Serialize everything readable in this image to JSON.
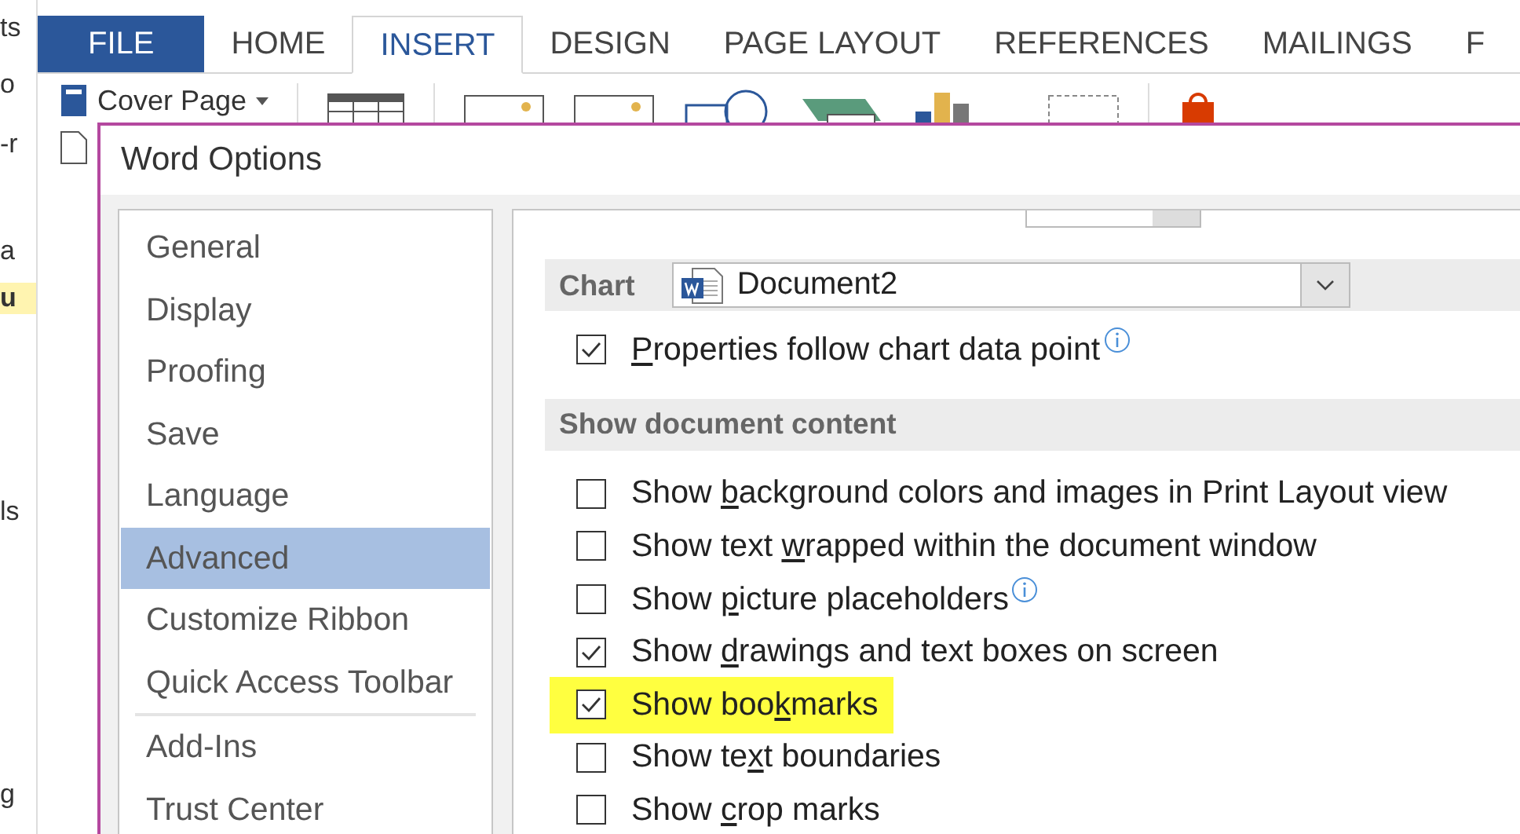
{
  "background_fragments": [
    {
      "text": "ts",
      "highlighted": false
    },
    {
      "text": "o",
      "highlighted": false
    },
    {
      "text": "-r",
      "highlighted": false
    },
    {
      "text": "a",
      "highlighted": false
    },
    {
      "text": "u",
      "highlighted": true
    },
    {
      "text": "ls",
      "highlighted": false
    },
    {
      "text": "g",
      "highlighted": false
    }
  ],
  "ribbon_tabs": [
    {
      "label": "FILE",
      "kind": "file",
      "selected": false
    },
    {
      "label": "HOME",
      "kind": "tab",
      "selected": false
    },
    {
      "label": "INSERT",
      "kind": "tab",
      "selected": true
    },
    {
      "label": "DESIGN",
      "kind": "tab",
      "selected": false
    },
    {
      "label": "PAGE LAYOUT",
      "kind": "tab",
      "selected": false
    },
    {
      "label": "REFERENCES",
      "kind": "tab",
      "selected": false
    },
    {
      "label": "MAILINGS",
      "kind": "tab",
      "selected": false
    },
    {
      "label": "F",
      "kind": "tab",
      "selected": false
    }
  ],
  "ribbon": {
    "cover_page": "Cover Page"
  },
  "dialog": {
    "title": "Word Options",
    "nav_groups": [
      [
        {
          "label": "General",
          "selected": false
        },
        {
          "label": "Display",
          "selected": false
        },
        {
          "label": "Proofing",
          "selected": false
        },
        {
          "label": "Save",
          "selected": false
        },
        {
          "label": "Language",
          "selected": false
        },
        {
          "label": "Advanced",
          "selected": true
        },
        {
          "label": "Customize Ribbon",
          "selected": false
        },
        {
          "label": "Quick Access Toolbar",
          "selected": false
        }
      ],
      [
        {
          "label": "Add-Ins",
          "selected": false
        },
        {
          "label": "Trust Center",
          "selected": false
        }
      ]
    ],
    "content": [
      {
        "kind": "picker",
        "label": "Chart",
        "value": "Document2"
      },
      {
        "kind": "checkbox",
        "mnemonic": "P",
        "label_end": "roperties follow chart data point",
        "checked": true,
        "info": true,
        "highlighted": false
      },
      {
        "kind": "header",
        "label": "Show document content"
      },
      {
        "kind": "checkbox",
        "label_start": "Show ",
        "mnemonic": "b",
        "label_end": "ackground colors and images in Print Layout view",
        "checked": false,
        "info": false,
        "highlighted": false
      },
      {
        "kind": "checkbox",
        "label_start": "Show text ",
        "mnemonic": "w",
        "label_end": "rapped within the document window",
        "checked": false,
        "info": false,
        "highlighted": false
      },
      {
        "kind": "checkbox",
        "label_start": "Show ",
        "mnemonic": "p",
        "label_end": "icture placeholders",
        "checked": false,
        "info": true,
        "highlighted": false
      },
      {
        "kind": "checkbox",
        "label_start": "Show ",
        "mnemonic": "d",
        "label_end": "rawings and text boxes on screen",
        "checked": true,
        "info": false,
        "highlighted": false
      },
      {
        "kind": "checkbox",
        "label_start": "Show boo",
        "mnemonic": "k",
        "label_end": "marks",
        "checked": true,
        "info": false,
        "highlighted": true
      },
      {
        "kind": "checkbox",
        "label_start": "Show te",
        "mnemonic": "x",
        "label_end": "t boundaries",
        "checked": false,
        "info": false,
        "highlighted": false
      },
      {
        "kind": "checkbox",
        "label_start": "Show ",
        "mnemonic": "c",
        "label_end": "rop marks",
        "checked": false,
        "info": false,
        "highlighted": false
      }
    ]
  }
}
